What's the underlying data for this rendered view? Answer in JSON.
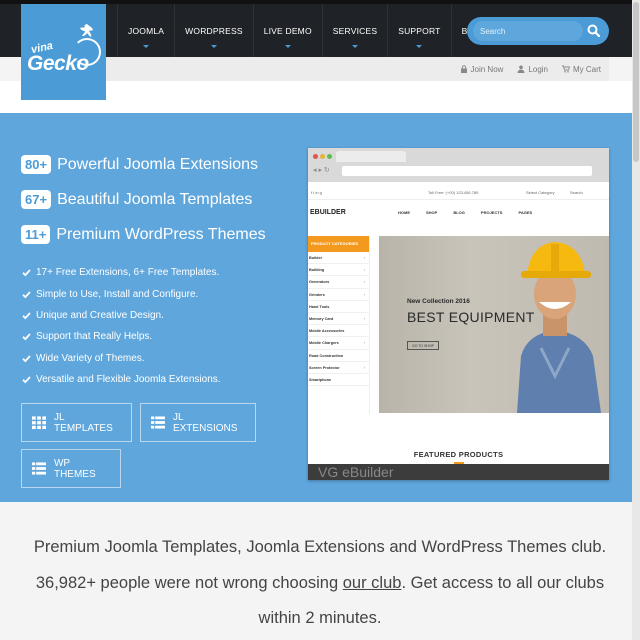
{
  "logo": {
    "line1": "vina",
    "line2": "Gecko"
  },
  "nav": {
    "items": [
      {
        "label": "JOOMLA",
        "caret": true
      },
      {
        "label": "WORDPRESS",
        "caret": true
      },
      {
        "label": "LIVE DEMO",
        "caret": true
      },
      {
        "label": "SERVICES",
        "caret": true
      },
      {
        "label": "SUPPORT",
        "caret": true
      },
      {
        "label": "BLOG",
        "caret": false
      }
    ],
    "search_placeholder": "Search"
  },
  "account": {
    "join": "Join Now",
    "login": "Login",
    "cart": "My Cart"
  },
  "hero": {
    "stats": [
      {
        "num": "80+",
        "text": "Powerful Joomla Extensions"
      },
      {
        "num": "67+",
        "text": "Beautiful Joomla Templates"
      },
      {
        "num": "11+",
        "text": "Premium WordPress Themes"
      }
    ],
    "features": [
      "17+ Free Extensions, 6+ Free Templates.",
      "Simple to Use, Install and Configure.",
      "Unique and Creative Design.",
      "Support that Really Helps.",
      "Wide Variety of Themes.",
      "Versatile and Flexible Joomla Extensions."
    ],
    "buttons": {
      "templates": "JL TEMPLATES",
      "extensions": "JL EXTENSIONS",
      "themes": "WP THEMES"
    }
  },
  "preview": {
    "topbar_phone": "Toll Free: (+00) 123.456.789",
    "topbar_select": "Select Category",
    "topbar_search": "Search",
    "logo": "EBUILDER",
    "menu": [
      "HOME",
      "SHOP",
      "BLOG",
      "PROJECTS",
      "PAGES"
    ],
    "sidebar_title": "PRODUCT CATEGORIES",
    "sidebar_items": [
      "Builder",
      "Building",
      "Generators",
      "Grinders",
      "Hand Tools",
      "Memory Card",
      "Mobile Accessories",
      "Mobile Chargers",
      "Road Construction",
      "Screen Protector",
      "Smartphone"
    ],
    "banner_small": "New Collection 2016",
    "banner_big": "BEST EQUIPMENT",
    "banner_button": "GO TO SHOP",
    "featured": "FEATURED PRODUCTS",
    "strip_text": "VG eBuilder"
  },
  "tagline": {
    "line1": "Premium Joomla Templates, Joomla Extensions and WordPress Themes club.",
    "line2_pre": "36,982+ people were not wrong choosing ",
    "line2_link": "our club",
    "line2_post": ". Get access to all our clubs",
    "line3": "within 2 minutes."
  },
  "colors": {
    "accent": "#4b9bd6",
    "hero": "#5fa6dc",
    "topbar": "#1f2226",
    "orange": "#f39a1e"
  },
  "icons": {
    "lock": "lock-icon",
    "user": "user-icon",
    "cart": "cart-icon",
    "search": "search-icon",
    "check": "check-icon",
    "grid": "grid-icon",
    "list": "list-icon"
  }
}
